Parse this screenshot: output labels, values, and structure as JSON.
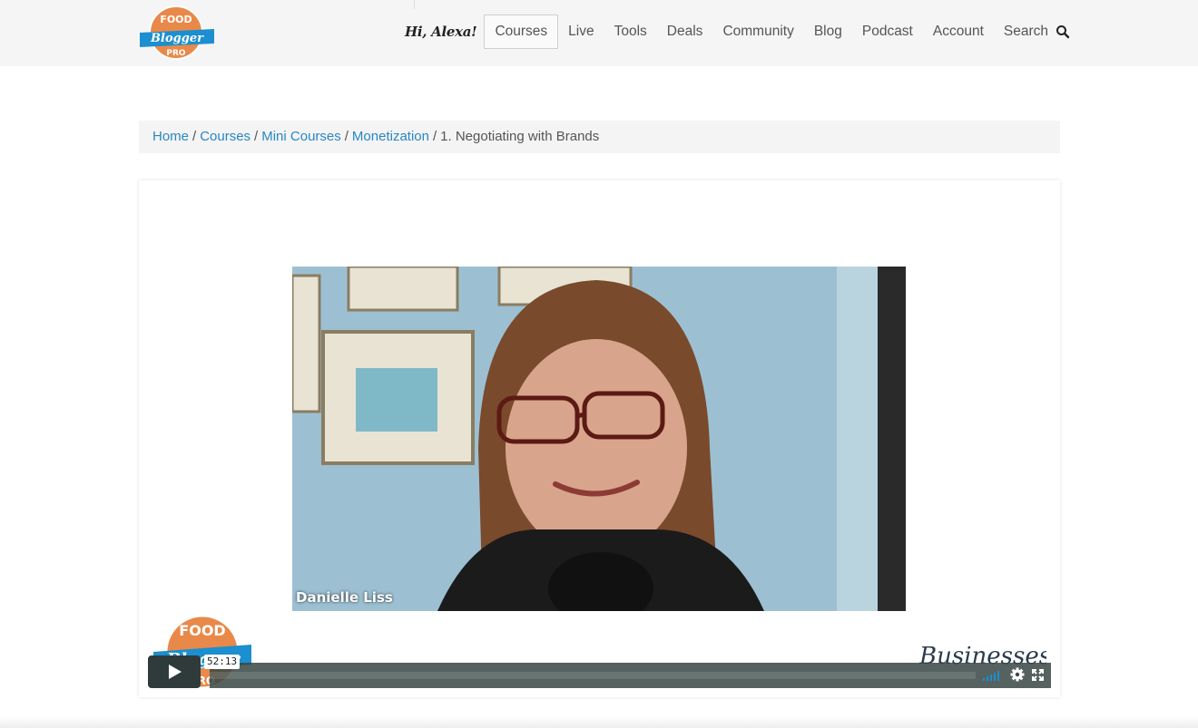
{
  "header": {
    "greeting": "Hi, Alexa!",
    "nav": [
      {
        "label": "Courses",
        "active": true
      },
      {
        "label": "Live"
      },
      {
        "label": "Tools"
      },
      {
        "label": "Deals"
      },
      {
        "label": "Community"
      },
      {
        "label": "Blog"
      },
      {
        "label": "Podcast"
      },
      {
        "label": "Account"
      },
      {
        "label": "Search"
      }
    ],
    "logo": {
      "line1": "FOOD",
      "line2": "Blogger",
      "line3": "PRO"
    }
  },
  "breadcrumb": {
    "items": [
      "Home",
      "Courses",
      "Mini Courses",
      "Monetization"
    ],
    "current": "1. Negotiating with Brands",
    "separator": "/"
  },
  "video": {
    "speaker_name": "Danielle Liss",
    "time": "52:13",
    "watermark_logo": {
      "line1": "FOOD",
      "line2": "Blogger",
      "line3": "PRO"
    },
    "watermark_text": "Businessese",
    "progress": 0
  },
  "colors": {
    "link": "#2a86c5",
    "logo_orange": "#e8894a",
    "logo_blue": "#1b8fcf",
    "player_bar": "#2f3b3a"
  }
}
